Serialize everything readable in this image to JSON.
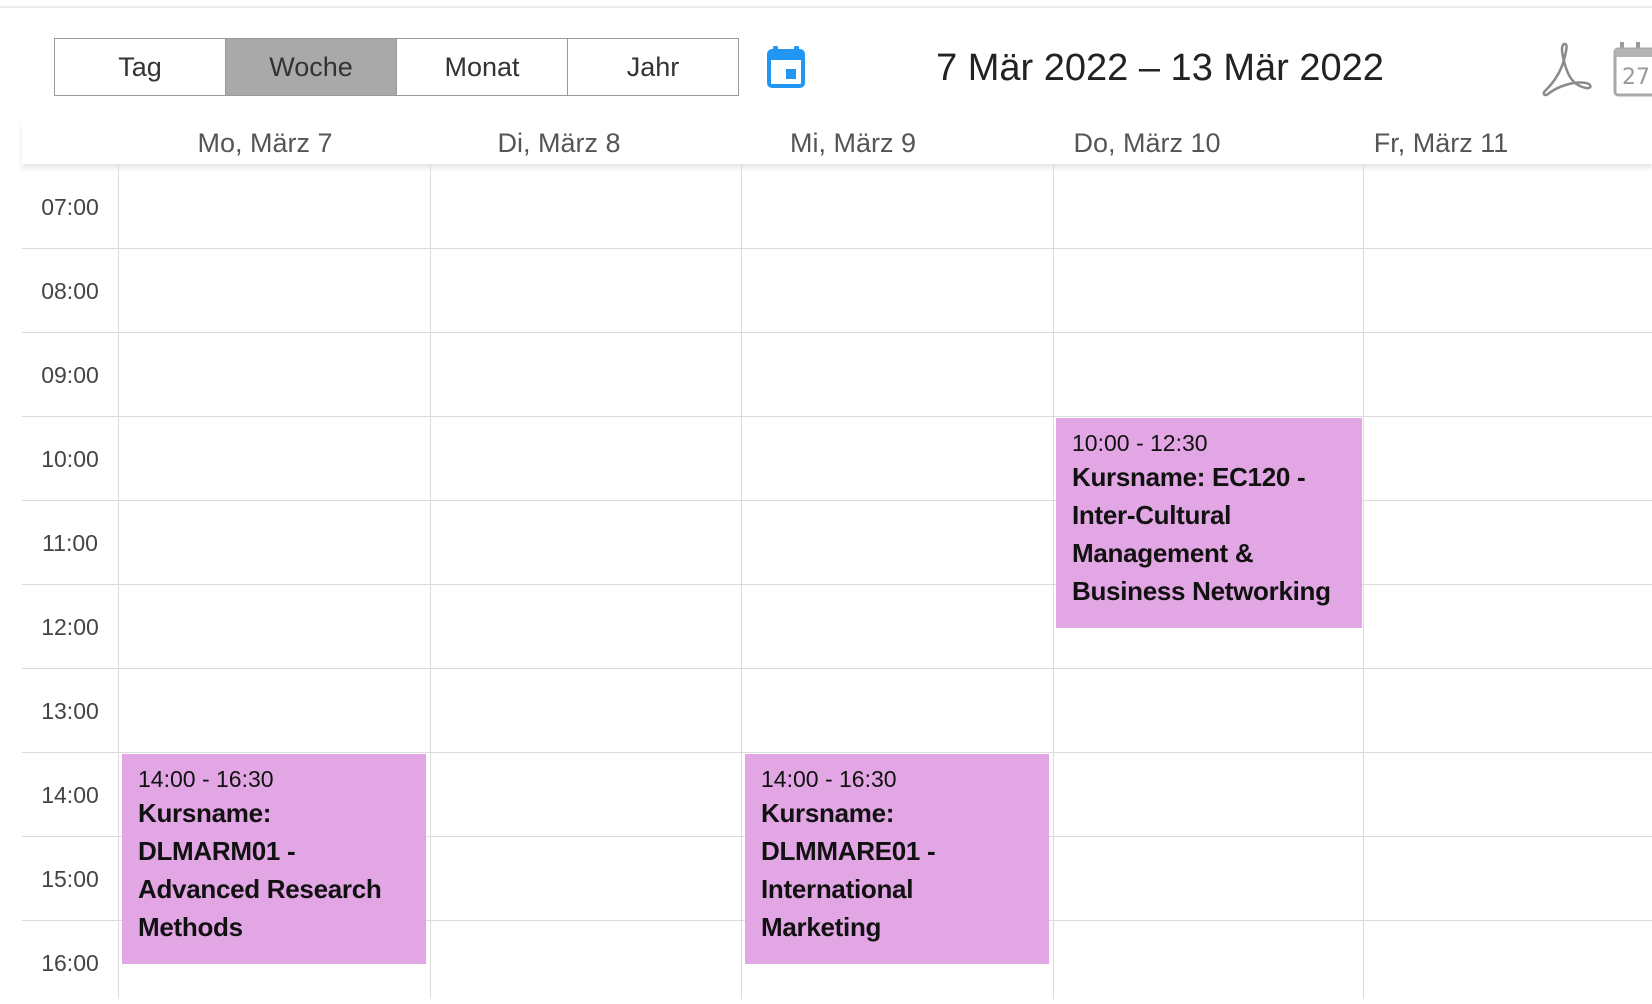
{
  "views": [
    {
      "label": "Tag",
      "active": false
    },
    {
      "label": "Woche",
      "active": true
    },
    {
      "label": "Monat",
      "active": false
    },
    {
      "label": "Jahr",
      "active": false
    }
  ],
  "date_range": "7 Mär 2022 – 13 Mär 2022",
  "days": [
    "Mo, März 7",
    "Di, März 8",
    "Mi, März 9",
    "Do, März 10",
    "Fr, März 11"
  ],
  "hours": [
    "07:00",
    "08:00",
    "09:00",
    "10:00",
    "11:00",
    "12:00",
    "13:00",
    "14:00",
    "15:00",
    "16:00"
  ],
  "events": [
    {
      "day": "Mo, März 7",
      "time": "14:00 - 16:30",
      "title": "Kursname: DLMARM01 - Advanced Research Methods"
    },
    {
      "day": "Mi, März 9",
      "time": "14:00 - 16:30",
      "title": "Kursname: DLMMARE01 - International Marketing"
    },
    {
      "day": "Do, März 10",
      "time": "10:00 - 12:30",
      "title": "Kursname: EC120 - Inter-Cultural Management & Business Networking"
    }
  ],
  "icons": {
    "date_picker": "calendar-icon",
    "pdf_export": "pdf-icon",
    "ical_export": "ical-calendar-icon",
    "ical_day": "27"
  },
  "colors": {
    "event_bg": "#e2a6e4",
    "active_view": "#a9a9a9",
    "accent": "#2196f3"
  }
}
